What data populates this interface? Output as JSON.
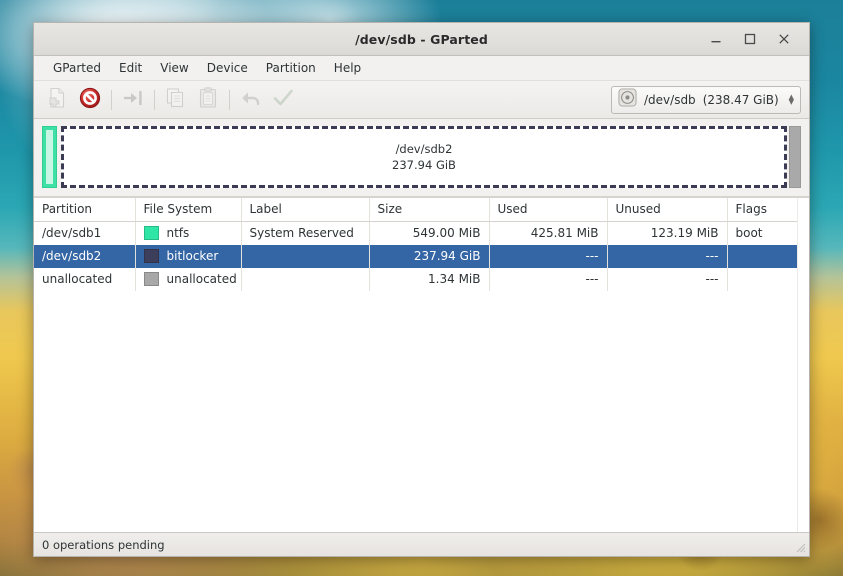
{
  "window": {
    "title": "/dev/sdb - GParted",
    "controls": {
      "minimize": "minimize-icon",
      "maximize": "maximize-icon",
      "close": "close-icon"
    }
  },
  "menubar": {
    "items": [
      {
        "label": "GParted"
      },
      {
        "label": "Edit"
      },
      {
        "label": "View"
      },
      {
        "label": "Device"
      },
      {
        "label": "Partition"
      },
      {
        "label": "Help"
      }
    ]
  },
  "toolbar": {
    "buttons": [
      {
        "name": "new-partition-button",
        "icon": "new-document-icon",
        "enabled": false
      },
      {
        "name": "delete-partition-button",
        "icon": "delete-prohibited-icon",
        "enabled": true
      },
      {
        "name": "resize-move-button",
        "icon": "resize-arrow-icon",
        "enabled": false
      },
      {
        "name": "copy-button",
        "icon": "copy-icon",
        "enabled": false
      },
      {
        "name": "paste-button",
        "icon": "paste-clipboard-icon",
        "enabled": false
      },
      {
        "name": "undo-button",
        "icon": "undo-arrow-icon",
        "enabled": false
      },
      {
        "name": "apply-button",
        "icon": "apply-checkmark-icon",
        "enabled": false
      }
    ],
    "device_selector": {
      "icon": "disk-platter-icon",
      "device": "/dev/sdb",
      "size": "(238.47 GiB)"
    }
  },
  "graphic": {
    "partitions": [
      {
        "name": "ntfs-block",
        "color": "#3fe0a5",
        "selected": false,
        "label": "",
        "size": ""
      },
      {
        "name": "bitlocker-block",
        "color": "#ffffff",
        "selected": true,
        "label": "/dev/sdb2",
        "size": "237.94 GiB"
      },
      {
        "name": "unallocated-block",
        "color": "#a9a9a9",
        "selected": false,
        "label": "",
        "size": ""
      }
    ]
  },
  "table": {
    "headers": [
      "Partition",
      "File System",
      "Label",
      "Size",
      "Used",
      "Unused",
      "Flags"
    ],
    "rows": [
      {
        "partition": "/dev/sdb1",
        "filesystem": "ntfs",
        "swatch": "#2fe6a7",
        "label": "System Reserved",
        "size": "549.00 MiB",
        "used": "425.81 MiB",
        "unused": "123.19 MiB",
        "flags": "boot",
        "selected": false
      },
      {
        "partition": "/dev/sdb2",
        "filesystem": "bitlocker",
        "swatch": "#3d3d5c",
        "label": "",
        "size": "237.94 GiB",
        "used": "---",
        "unused": "---",
        "flags": "",
        "selected": true
      },
      {
        "partition": "unallocated",
        "filesystem": "unallocated",
        "swatch": "#a8a8a8",
        "label": "",
        "size": "1.34 MiB",
        "used": "---",
        "unused": "---",
        "flags": "",
        "selected": false
      }
    ]
  },
  "statusbar": {
    "text": "0 operations pending"
  },
  "colors": {
    "selection_blue": "#3465a4",
    "ntfs_green": "#2fe6a7",
    "bitlocker_navy": "#3d3d5c",
    "unallocated_grey": "#a8a8a8",
    "window_chrome": "#f2f1f0"
  }
}
